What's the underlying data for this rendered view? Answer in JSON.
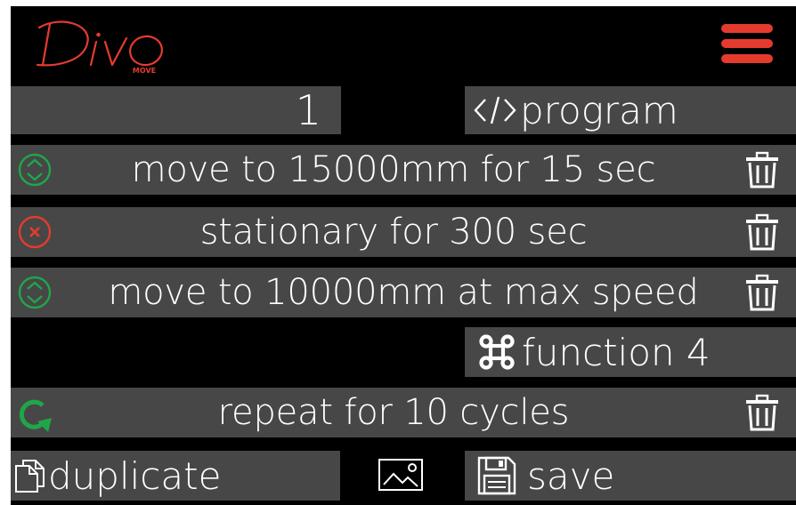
{
  "app": {
    "logo_text": "Divo",
    "logo_sub": "MOVE",
    "menu_icon": "hamburger-menu-icon"
  },
  "colors": {
    "brand_red": "#e53b2f",
    "bar_gray": "#474747",
    "green": "#1fa64a",
    "background": "#000000",
    "text": "#ffffff"
  },
  "program": {
    "number": "1",
    "label": "program",
    "icon": "code-icon"
  },
  "steps": [
    {
      "text": "move to 15000mm for 15 sec",
      "status_icon": "green-updown-circle-icon",
      "delete_icon": "trash-icon"
    },
    {
      "text": "stationary for 300 sec",
      "status_icon": "red-x-circle-icon",
      "delete_icon": "trash-icon"
    },
    {
      "text": "move to 10000mm at max speed",
      "status_icon": "green-updown-circle-icon",
      "delete_icon": "trash-icon"
    }
  ],
  "function": {
    "label": "function 4",
    "icon": "command-icon"
  },
  "repeat": {
    "text": "repeat for 10 cycles",
    "icon": "green-repeat-arrow-icon",
    "delete_icon": "trash-icon"
  },
  "footer": {
    "duplicate_label": "duplicate",
    "duplicate_icon": "copy-icon",
    "image_icon": "image-icon",
    "save_label": "save",
    "save_icon": "floppy-disk-icon"
  }
}
